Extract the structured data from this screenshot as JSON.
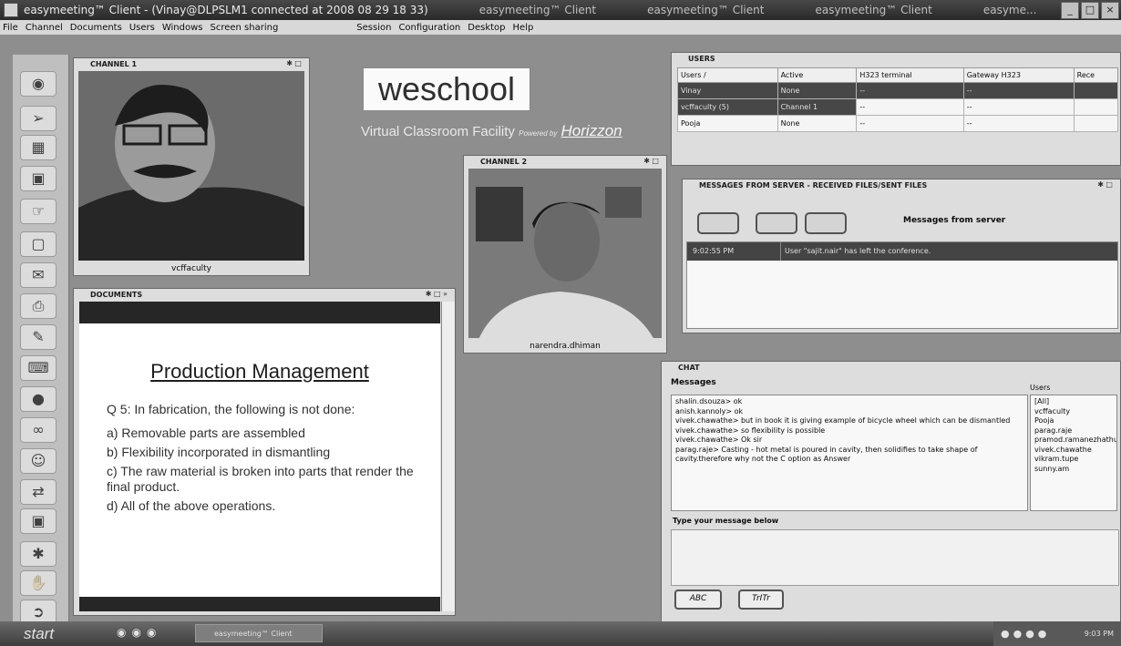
{
  "window": {
    "title": "easymeeting™ Client - (Vinay@DLPSLM1 connected at 2008 08 29 18 33)",
    "taskbar_titles": [
      "easymeeting™ Client",
      "easymeeting™ Client",
      "easymeeting™ Client",
      "easyme..."
    ],
    "buttons": [
      "_",
      "□",
      "×"
    ]
  },
  "menu": {
    "left": [
      "File",
      "Channel",
      "Documents",
      "Users",
      "Windows",
      "Screen sharing"
    ],
    "right": [
      "Session",
      "Configuration",
      "Desktop",
      "Help"
    ]
  },
  "channel1": {
    "title": "CHANNEL 1",
    "user": "vcffaculty"
  },
  "channel2": {
    "title": "CHANNEL 2",
    "user": "narendra.dhiman"
  },
  "documents": {
    "title": "DOCUMENTS",
    "heading": "Production Management",
    "question": "Q 5: In fabrication, the following is not done:",
    "options": [
      "a)  Removable parts are assembled",
      "b)  Flexibility incorporated in dismantling",
      "c)  The raw material is broken into parts that render the final product.",
      "d)  All of the above operations."
    ]
  },
  "branding": {
    "logo": "weschool",
    "tagline": "Virtual Classroom Facility",
    "powered": "Powered by",
    "partner": "Horizzon"
  },
  "users": {
    "title": "USERS",
    "columns": [
      "Users /",
      "Active",
      "H323 terminal",
      "Gateway H323",
      "Rece"
    ],
    "rows": [
      [
        "Vinay",
        "None",
        "--",
        "--",
        ""
      ],
      [
        "vcffaculty (5)",
        "Channel 1",
        "--",
        "--",
        ""
      ],
      [
        "Pooja",
        "None",
        "--",
        "--",
        ""
      ]
    ]
  },
  "messages": {
    "title": "MESSAGES FROM SERVER - RECEIVED FILES/SENT FILES",
    "label": "Messages from server",
    "entries": [
      {
        "time": "9:02:55 PM",
        "text": "User \"sajit.nair\" has left the conference."
      }
    ]
  },
  "chat": {
    "title": "CHAT",
    "messages_label": "Messages",
    "users_label": "Users",
    "lines": [
      "shalin.dsouza> ok",
      "anish.kannoly> ok",
      "vivek.chawathe> but in book it is giving example of bicycle wheel which can be dismantled",
      "vivek.chawathe> so flexibility is possible",
      "vivek.chawathe> Ok sir",
      "parag.raje> Casting - hot metal is poured in cavity, then solidifies to take shape of cavity.therefore why not the C option as Answer"
    ],
    "users": [
      "[All]",
      "vcffaculty",
      "Pooja",
      "parag.raje",
      "pramod.ramanezhathu",
      "vivek.chawathe",
      "vikram.tupe",
      "sunny.am"
    ],
    "type_label": "Type your message below",
    "fmt1": "ABC",
    "fmt2": "TrITr"
  },
  "taskbar": {
    "start": "start",
    "item": "easymeeting™ Client",
    "clock": "9:03 PM"
  }
}
